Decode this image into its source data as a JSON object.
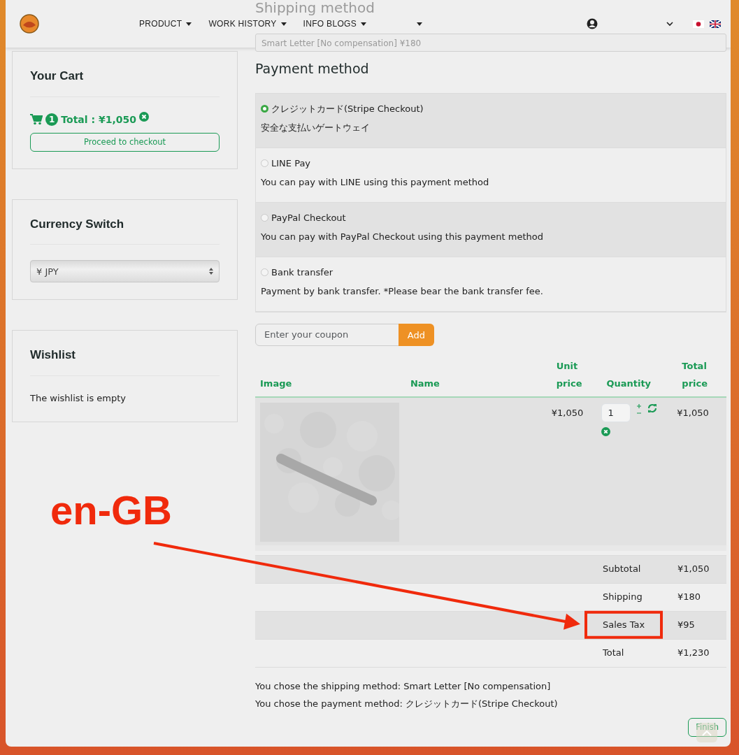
{
  "navbar": {
    "menus": [
      {
        "label": "PRODUCT"
      },
      {
        "label": "WORK HISTORY"
      },
      {
        "label": "INFO BLOGS"
      }
    ]
  },
  "shipping": {
    "title": "Shipping method",
    "selected_option": "Smart Letter [No compensation] ¥180"
  },
  "cart": {
    "title": "Your Cart",
    "count": "1",
    "total": "Total : ¥1,050",
    "button": "Proceed to checkout"
  },
  "currency": {
    "title": "Currency Switch",
    "value": "¥ JPY"
  },
  "wishlist": {
    "title": "Wishlist",
    "message": "The wishlist is empty"
  },
  "payment": {
    "title": "Payment method",
    "options": [
      {
        "name": "クレジットカード(Stripe Checkout)",
        "description": "安全な支払いゲートウェイ",
        "selected": true
      },
      {
        "name": "LINE Pay",
        "description": "You can pay with LINE using this payment method",
        "selected": false
      },
      {
        "name": "PayPal Checkout",
        "description": "You can pay with PayPal Checkout using this payment method",
        "selected": false
      },
      {
        "name": "Bank transfer",
        "description": "Payment by bank transfer. *Please bear the bank transfer fee.",
        "selected": false
      }
    ]
  },
  "coupon": {
    "placeholder": "Enter your coupon",
    "button": "Add"
  },
  "table": {
    "columns": [
      "Image",
      "Name",
      "Unit price",
      "Quantity",
      "Total price"
    ],
    "rows": [
      {
        "unit_price": "¥1,050",
        "quantity": "1",
        "total_price": "¥1,050"
      }
    ]
  },
  "totals": [
    {
      "label": "Subtotal",
      "value": "¥1,050",
      "highlighted": false
    },
    {
      "label": "Shipping",
      "value": "¥180",
      "highlighted": false
    },
    {
      "label": "Sales Tax",
      "value": "¥95",
      "highlighted": true
    },
    {
      "label": "Total",
      "value": "¥1,230",
      "highlighted": false
    }
  ],
  "summary": [
    "You chose the shipping method: Smart Letter [No compensation]",
    "You chose the payment method: クレジットカード(Stripe Checkout)"
  ],
  "finish_button": "Finish",
  "annotation": {
    "label": "en-GB"
  }
}
